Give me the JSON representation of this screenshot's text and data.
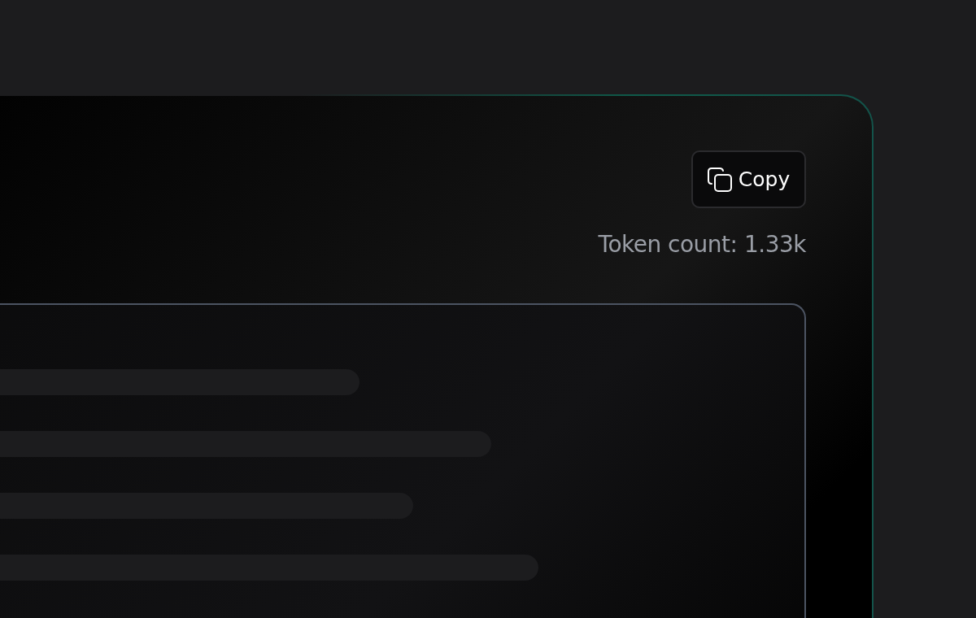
{
  "copy_button": {
    "label": "Copy"
  },
  "token_count": "Token count: 1.33k"
}
